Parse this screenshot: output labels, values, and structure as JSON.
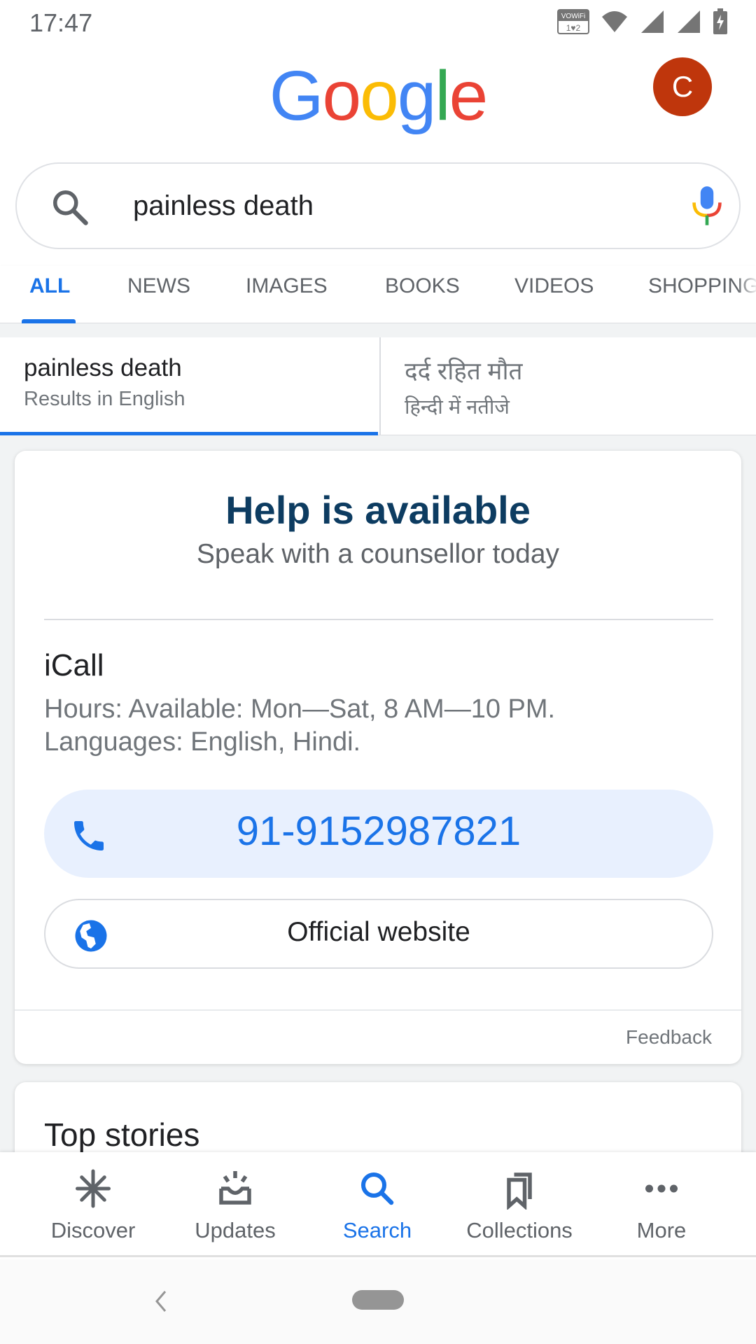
{
  "status_bar": {
    "time": "17:47",
    "icons": [
      "vowifi-icon",
      "wifi-icon",
      "signal-icon",
      "signal-icon",
      "battery-charging-icon"
    ],
    "vowifi_label": "VOWiFi"
  },
  "header": {
    "logo": [
      "G",
      "o",
      "o",
      "g",
      "l",
      "e"
    ],
    "logo_colors": [
      "#4285f4",
      "#ea4335",
      "#fbbc05",
      "#4285f4",
      "#34a853",
      "#ea4335"
    ],
    "avatar_initial": "C",
    "avatar_color": "#bf360c"
  },
  "search": {
    "query": "painless death",
    "icon": "search-icon",
    "mic_icon": "mic-icon"
  },
  "tabs": [
    {
      "label": "ALL",
      "active": true
    },
    {
      "label": "NEWS"
    },
    {
      "label": "IMAGES"
    },
    {
      "label": "BOOKS"
    },
    {
      "label": "VIDEOS"
    },
    {
      "label": "SHOPPING"
    }
  ],
  "language_toggle": {
    "left": {
      "query": "painless death",
      "caption": "Results in English",
      "selected": true
    },
    "right": {
      "query": "दर्द रहित मौत",
      "caption": "हिन्दी में नतीजे"
    }
  },
  "help_card": {
    "title": "Help is available",
    "subtitle": "Speak with a counsellor today",
    "org": "iCall",
    "hours": "Hours: Available: Mon—Sat, 8 AM—10 PM.",
    "languages": "Languages: English, Hindi.",
    "phone": "91-9152987821",
    "website_label": "Official website",
    "feedback": "Feedback"
  },
  "top_stories": {
    "title": "Top stories"
  },
  "bottom_nav": [
    {
      "label": "Discover",
      "icon": "asterisk-icon"
    },
    {
      "label": "Updates",
      "icon": "updates-inbox-icon"
    },
    {
      "label": "Search",
      "icon": "search-icon",
      "active": true
    },
    {
      "label": "Collections",
      "icon": "bookmarks-icon"
    },
    {
      "label": "More",
      "icon": "more-dots-icon"
    }
  ],
  "colors": {
    "accent": "#1a73e8",
    "title": "#0d3c61",
    "text_secondary": "#70757a"
  }
}
